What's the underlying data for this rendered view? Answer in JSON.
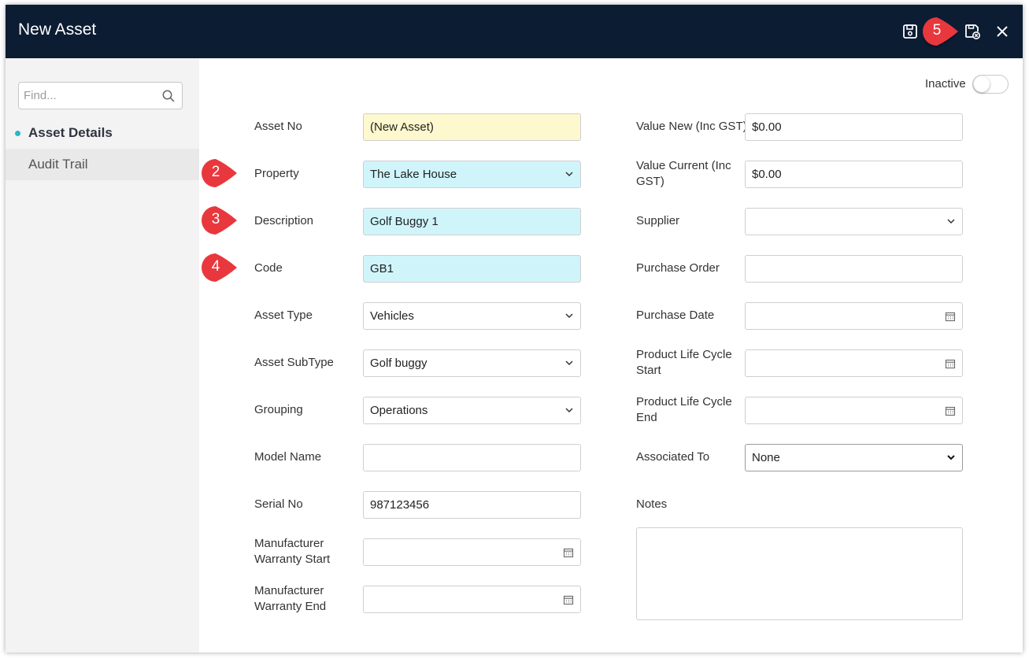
{
  "window": {
    "title": "New Asset",
    "buttons": {
      "save_icon": "save-icon",
      "save_close_icon": "save-close-icon",
      "close_icon": "close-icon"
    }
  },
  "sidebar": {
    "search_placeholder": "Find...",
    "items": [
      {
        "label": "Asset Details",
        "active": true
      },
      {
        "label": "Audit Trail",
        "active": false
      }
    ]
  },
  "form": {
    "inactive_label": "Inactive",
    "left": {
      "asset_no": {
        "label": "Asset No",
        "value": "(New Asset)"
      },
      "property": {
        "label": "Property",
        "value": "The Lake House"
      },
      "description": {
        "label": "Description",
        "value": "Golf Buggy 1"
      },
      "code": {
        "label": "Code",
        "value": "GB1"
      },
      "asset_type": {
        "label": "Asset Type",
        "value": "Vehicles"
      },
      "asset_subtype": {
        "label": "Asset SubType",
        "value": "Golf buggy"
      },
      "grouping": {
        "label": "Grouping",
        "value": "Operations"
      },
      "model_name": {
        "label": "Model Name",
        "value": ""
      },
      "serial_no": {
        "label": "Serial No",
        "value": "987123456"
      },
      "warranty_start": {
        "label_line1": "Manufacturer",
        "label_line2": "Warranty Start",
        "value": ""
      },
      "warranty_end": {
        "label_line1": "Manufacturer",
        "label_line2": "Warranty End",
        "value": ""
      }
    },
    "right": {
      "value_new": {
        "label": "Value New (Inc GST)",
        "value": "$0.00"
      },
      "value_current": {
        "label_line1": "Value Current (Inc",
        "label_line2": "GST)",
        "value": "$0.00"
      },
      "supplier": {
        "label": "Supplier",
        "value": ""
      },
      "purchase_order": {
        "label": "Purchase Order",
        "value": ""
      },
      "purchase_date": {
        "label": "Purchase Date",
        "value": ""
      },
      "plc_start": {
        "label_line1": "Product Life Cycle",
        "label_line2": "Start",
        "value": ""
      },
      "plc_end": {
        "label_line1": "Product Life Cycle",
        "label_line2": "End",
        "value": ""
      },
      "associated_to": {
        "label": "Associated To",
        "value": "None"
      },
      "notes": {
        "label": "Notes",
        "value": ""
      }
    }
  },
  "callouts": [
    "2",
    "3",
    "4",
    "5"
  ],
  "colors": {
    "titlebar": "#0c1c33",
    "callout": "#e8383d",
    "required_field": "#cff5fb",
    "readonly_field": "#fdf8cd",
    "active_dot": "#26b8c8"
  }
}
